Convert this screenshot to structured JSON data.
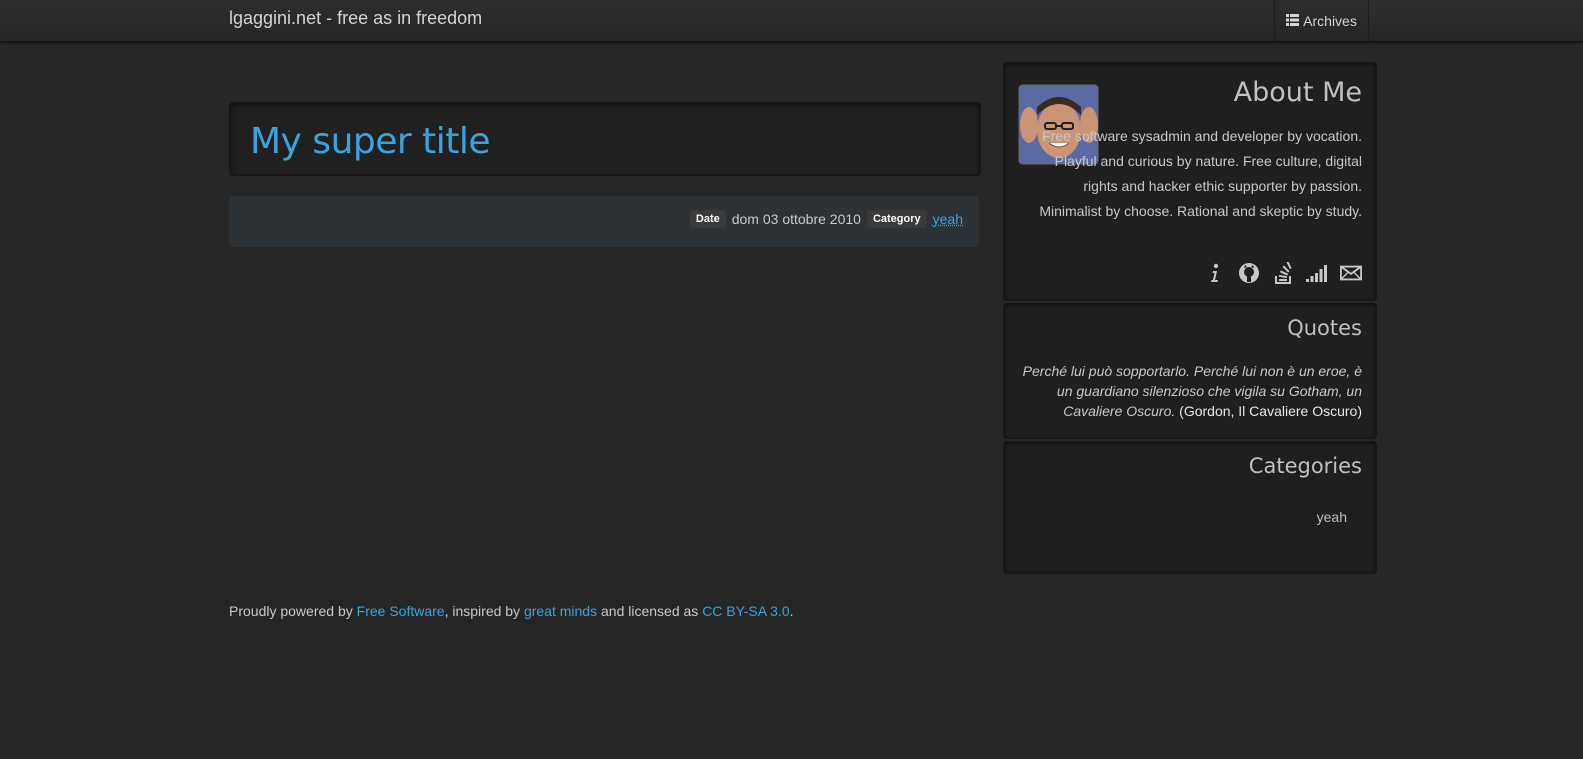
{
  "navbar": {
    "brand": "lgaggini.net - free as in freedom",
    "archives_label": "Archives",
    "archives_icon": "list-icon"
  },
  "post": {
    "title": "My super title",
    "date_label": "Date",
    "date_value": "dom 03 ottobre 2010",
    "category_label": "Category",
    "category_value": "yeah"
  },
  "sidebar": {
    "about": {
      "heading": "About Me",
      "text": "Free software sysadmin and developer by vocation. Playful and curious by nature. Free culture, digital rights and hacker ethic supporter by passion. Minimalist by choose. Rational and skeptic by study.",
      "social_icons": [
        "info-icon",
        "github-icon",
        "stackoverflow-icon",
        "signal-icon",
        "mail-icon"
      ]
    },
    "quotes": {
      "heading": "Quotes",
      "quote_text": "Perché lui può sopportarlo. Perché lui non è un eroe, è un guardiano silenzioso che vigila su Gotham, un Cavaliere Oscuro.",
      "quote_source": "(Gordon, Il Cavaliere Oscuro)"
    },
    "categories": {
      "heading": "Categories",
      "items": [
        "yeah"
      ]
    }
  },
  "footer": {
    "prefix": "Proudly powered by ",
    "link1": "Free Software",
    "mid1": ", inspired by ",
    "link2": "great minds",
    "mid2": " and licensed as ",
    "link3": "CC BY-SA 3.0",
    "suffix": "."
  },
  "colors": {
    "background": "#262626",
    "accent": "#3aa3de",
    "meta_bar": "#2d3237"
  }
}
